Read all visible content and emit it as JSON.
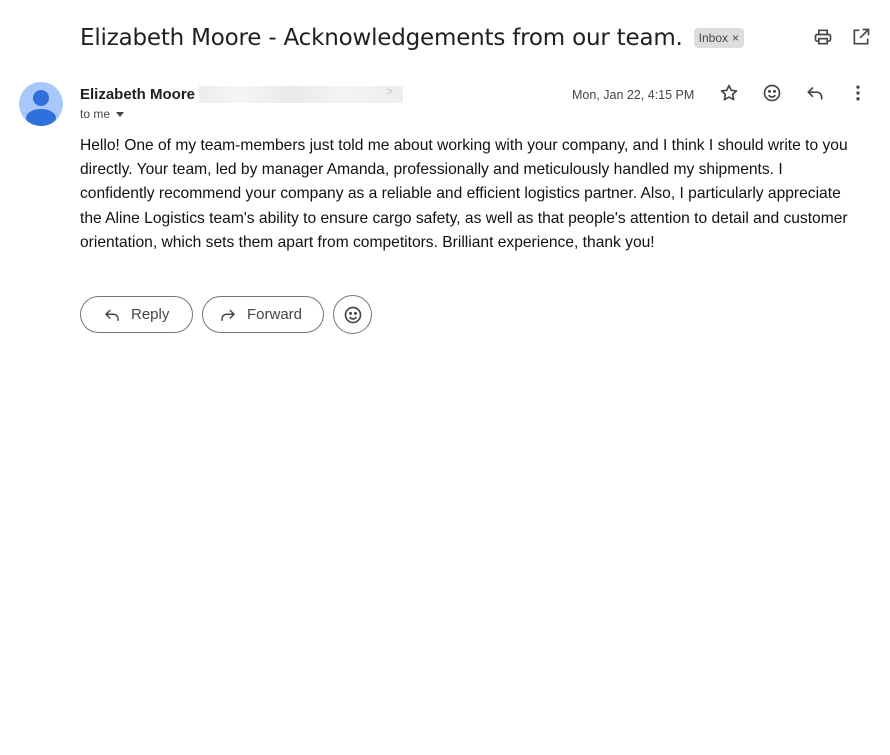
{
  "email": {
    "subject": "Elizabeth Moore - Acknowledgements from our team.",
    "label": "Inbox",
    "label_remove": "×",
    "sender_name": "Elizabeth Moore",
    "sender_email_suffix": ">",
    "recipient": "to me",
    "date": "Mon, Jan 22, 4:15 PM",
    "body_lines": [
      "Hello! One of my team-members just told me about working with your company, and I think I should write to you",
      "directly. Your team, led by manager Amanda, professionally and meticulously handled my shipments. I",
      "confidently recommend your company as a reliable and efficient logistics partner. Also, I particularly appreciate",
      "the Aline Logistics team's ability to ensure cargo safety, as well as that people's attention to detail and customer",
      "orientation, which sets them apart from competitors. Brilliant experience, thank you!"
    ]
  },
  "actions": {
    "reply_label": "Reply",
    "forward_label": "Forward"
  },
  "icons": {
    "print": "print-icon",
    "open_new_window": "open-in-new-icon",
    "star": "star-icon",
    "emoji": "emoji-icon",
    "reply": "reply-icon",
    "more": "more-vert-icon",
    "forward": "forward-icon",
    "avatar": "person-icon"
  },
  "colors": {
    "avatar_bg": "#a8c7fa",
    "avatar_fg": "#2f6fde",
    "chip_bg": "#dddddd",
    "icon": "#444746"
  }
}
